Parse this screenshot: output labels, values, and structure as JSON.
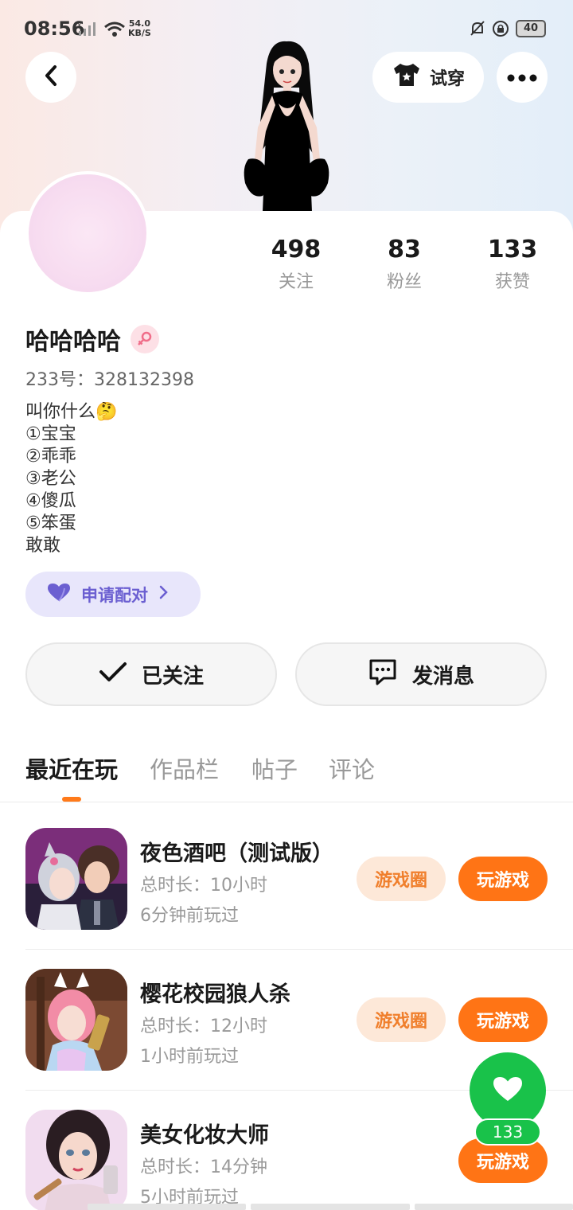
{
  "status_bar": {
    "time": "08:56",
    "net_speed_value": "54.0",
    "net_speed_unit": "KB/S",
    "battery": "40"
  },
  "header": {
    "try_on_label": "试穿"
  },
  "profile": {
    "stats": [
      {
        "value": "498",
        "label": "关注"
      },
      {
        "value": "83",
        "label": "粉丝"
      },
      {
        "value": "133",
        "label": "获赞"
      }
    ],
    "username": "哈哈哈哈",
    "uid": "233号：328132398",
    "bio_lines": [
      "叫你什么🤔",
      "①宝宝",
      "②乖乖",
      "③老公",
      "④傻瓜",
      "⑤笨蛋",
      "敢敢"
    ],
    "pair_label": "申请配对"
  },
  "actions": {
    "follow_label": "已关注",
    "message_label": "发消息"
  },
  "tabs": [
    "最近在玩",
    "作品栏",
    "帖子",
    "评论"
  ],
  "games": [
    {
      "title": "夜色酒吧（测试版）",
      "duration": "总时长：10小时",
      "last_played": "6分钟前玩过",
      "circle_label": "游戏圈",
      "play_label": "玩游戏"
    },
    {
      "title": "樱花校园狼人杀",
      "duration": "总时长：12小时",
      "last_played": "1小时前玩过",
      "circle_label": "游戏圈",
      "play_label": "玩游戏"
    },
    {
      "title": "美女化妆大师",
      "duration": "总时长：14分钟",
      "last_played": "5小时前玩过",
      "play_label": "玩游戏"
    }
  ],
  "like_fab": {
    "count": "133"
  },
  "colors": {
    "accent_orange": "#ff7415",
    "like_green": "#19c24a",
    "pair_purple": "#6b5fd1"
  },
  "icons": [
    "signal-icon",
    "wifi-icon",
    "bell-muted-icon",
    "lock-rotate-icon",
    "battery-icon",
    "back-arrow-icon",
    "tshirt-icon",
    "more-dots-icon",
    "female-icon",
    "heart-icon",
    "check-icon",
    "chat-bubble-icon",
    "chevron-right-icon"
  ]
}
